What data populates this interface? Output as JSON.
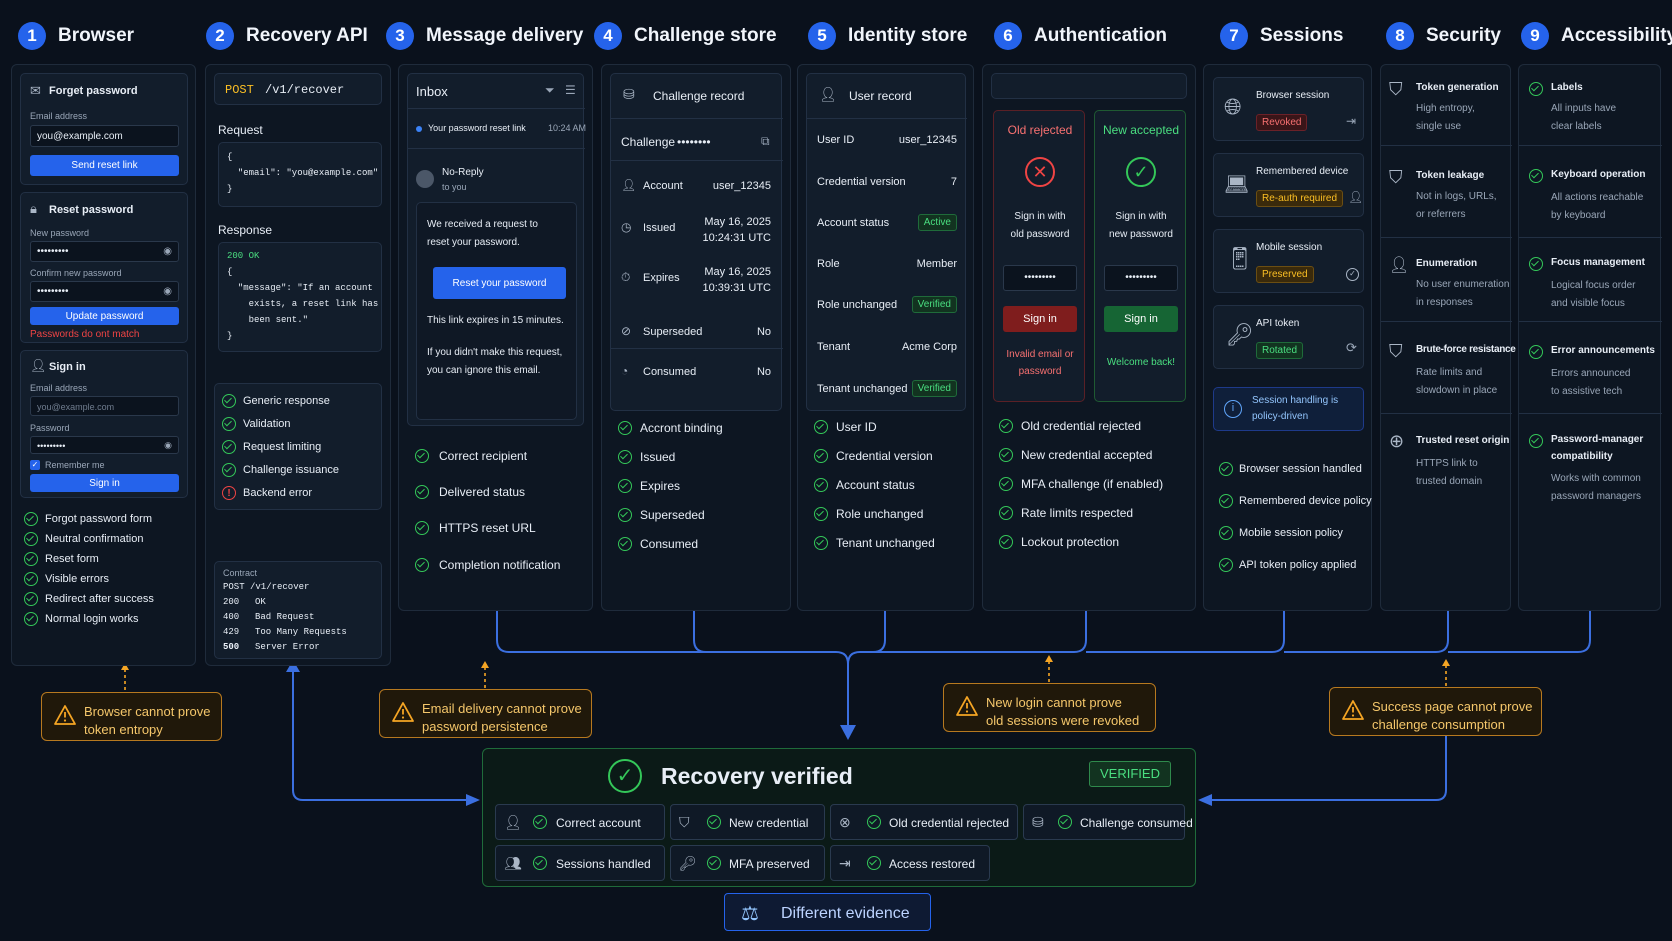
{
  "headers": [
    {
      "n": "1",
      "label": "Browser"
    },
    {
      "n": "2",
      "label": "Recovery API"
    },
    {
      "n": "3",
      "label": "Message delivery"
    },
    {
      "n": "4",
      "label": "Challenge store"
    },
    {
      "n": "5",
      "label": "Identity store"
    },
    {
      "n": "6",
      "label": "Authentication"
    },
    {
      "n": "7",
      "label": "Sessions"
    },
    {
      "n": "8",
      "label": "Security"
    },
    {
      "n": "9",
      "label": "Accessibility"
    }
  ],
  "browser": {
    "forgot": {
      "title": "Forget password",
      "email_label": "Email address",
      "email_value": "you@example.com",
      "button": "Send reset link"
    },
    "reset": {
      "title": "Reset password",
      "new_label": "New password",
      "new_value": "•••••••••",
      "confirm_label": "Confirm new password",
      "confirm_value": "•••••••••",
      "button": "Update password",
      "error": "Passwords do ont match"
    },
    "signin": {
      "title": "Sign in",
      "email_label": "Email address",
      "email_placeholder": "you@example.com",
      "pw_label": "Password",
      "pw_value": "•••••••••",
      "remember": "Remember me",
      "button": "Sign in"
    },
    "checks": [
      "Forgot password form",
      "Neutral confirmation",
      "Reset form",
      "Visible errors",
      "Redirect after success",
      "Normal login works"
    ]
  },
  "api": {
    "method": "POST",
    "path": "/v1/recover",
    "request_label": "Request",
    "request_lines": [
      "{",
      "  \"email\": \"you@example.com\"",
      "}"
    ],
    "response_label": "Response",
    "response_status": "200 OK",
    "response_lines": [
      "{",
      "  \"message\": \"If an account",
      "    exists, a reset link has",
      "    been sent.\"",
      "}"
    ],
    "checks": [
      "Generic response",
      "Validation",
      "Request limiting",
      "Challenge issuance"
    ],
    "error_item": "Backend error",
    "contract_label": "Contract",
    "contract_head": "POST /v1/recover",
    "contract": [
      {
        "code": "200",
        "text": "OK"
      },
      {
        "code": "400",
        "text": "Bad Request"
      },
      {
        "code": "429",
        "text": "Too Many Requests"
      },
      {
        "code": "500",
        "text": "Server Error"
      }
    ]
  },
  "msg": {
    "inbox": "Inbox",
    "subject": "Your password reset link",
    "time": "10:24 AM",
    "from": "No-Reply",
    "to": "to you",
    "body1": "We received a request to",
    "body2": "reset your password.",
    "button": "Reset your password",
    "body3": "This link expires in 15 minutes.",
    "body4": "If you didn't make this request,",
    "body5": "you can ignore this email.",
    "checks": [
      "Correct recipient",
      "Delivered status",
      "HTTPS reset URL",
      "Completion notification"
    ]
  },
  "challenge": {
    "title": "Challenge record",
    "challenge_label": "Challenge",
    "challenge_value": "••••••••",
    "rows": [
      {
        "label": "Account",
        "value": "user_12345"
      },
      {
        "label": "Issued",
        "value": "May 16, 2025",
        "value2": "10:24:31 UTC"
      },
      {
        "label": "Expires",
        "value": "May 16, 2025",
        "value2": "10:39:31 UTC"
      },
      {
        "label": "Superseded",
        "value": "No"
      },
      {
        "label": "Consumed",
        "value": "No"
      }
    ],
    "checks": [
      "Accront binding",
      "Issued",
      "Expires",
      "Superseded",
      "Consumed"
    ]
  },
  "identity": {
    "title": "User record",
    "rows": [
      {
        "label": "User ID",
        "value": "user_12345"
      },
      {
        "label": "Credential version",
        "value": "7"
      },
      {
        "label": "Account status",
        "badge": "Active"
      },
      {
        "label": "Role",
        "value": "Member"
      },
      {
        "label": "Role unchanged",
        "badge": "Verified"
      },
      {
        "label": "Tenant",
        "value": "Acme Corp"
      },
      {
        "label": "Tenant unchanged",
        "badge": "Verified"
      }
    ],
    "checks": [
      "User ID",
      "Credential version",
      "Account status",
      "Role unchanged",
      "Tenant unchanged"
    ]
  },
  "auth": {
    "old_title": "Old rejected",
    "old_text1": "Sign in with",
    "old_text2": "old password",
    "old_pw": "•••••••••",
    "old_button": "Sign in",
    "old_msg1": "Invalid email or",
    "old_msg2": "password",
    "new_title": "New accepted",
    "new_text1": "Sign in with",
    "new_text2": "new password",
    "new_pw": "•••••••••",
    "new_button": "Sign in",
    "new_msg": "Welcome back!",
    "checks": [
      "Old credential rejected",
      "New credential accepted",
      "MFA challenge (if enabled)",
      "Rate limits respected",
      "Lockout protection"
    ]
  },
  "sessions": {
    "items": [
      {
        "title": "Browser session",
        "badge": "Revoked"
      },
      {
        "title": "Remembered device",
        "badge": "Re-auth required"
      },
      {
        "title": "Mobile session",
        "badge": "Preserved"
      },
      {
        "title": "API token",
        "badge": "Rotated"
      }
    ],
    "info1": "Session handling is",
    "info2": "policy-driven",
    "checks": [
      "Browser session handled",
      "Remembered device policy",
      "Mobile session policy",
      "API token policy applied"
    ]
  },
  "security": [
    {
      "title": "Token generation",
      "l1": "High entropy,",
      "l2": "single use"
    },
    {
      "title": "Token leakage",
      "l1": "Not in logs, URLs,",
      "l2": "or referrers"
    },
    {
      "title": "Enumeration",
      "l1": "No user enumeration",
      "l2": "in responses"
    },
    {
      "title": "Brute-force resistance",
      "l1": "Rate limits and",
      "l2": "slowdown in place"
    },
    {
      "title": "Trusted reset origin",
      "l1": "HTTPS link to",
      "l2": "trusted domain"
    }
  ],
  "a11y": [
    {
      "title": "Labels",
      "l1": "All inputs have",
      "l2": "clear labels"
    },
    {
      "title": "Keyboard operation",
      "l1": "All actions reachable",
      "l2": "by keyboard"
    },
    {
      "title": "Focus management",
      "l1": "Logical focus order",
      "l2": "and visible focus"
    },
    {
      "title": "Error announcements",
      "l1": "Errors announced",
      "l2": "to assistive tech"
    },
    {
      "title": "Password-manager",
      "title2": "compatibility",
      "l1": "Works with common",
      "l2": "password managers"
    }
  ],
  "warnings": [
    {
      "l1": "Browser cannot prove",
      "l2": "token entropy"
    },
    {
      "l1": "Email delivery cannot prove",
      "l2": "password persistence"
    },
    {
      "l1": "New login cannot prove",
      "l2": "old sessions were revoked"
    },
    {
      "l1": "Success page cannot prove",
      "l2": "challenge consumption"
    }
  ],
  "verified": {
    "title": "Recovery verified",
    "badge": "VERIFIED",
    "items": [
      "Correct account",
      "New credential",
      "Old credential rejected",
      "Challenge consumed",
      "Sessions handled",
      "MFA preserved",
      "Access restored"
    ]
  },
  "evidence": "Different evidence",
  "colors": {
    "accent": "#2563eb",
    "green": "#34c759",
    "red": "#ef4444",
    "amber": "#f5a524",
    "flow": "#3b6fe0"
  }
}
